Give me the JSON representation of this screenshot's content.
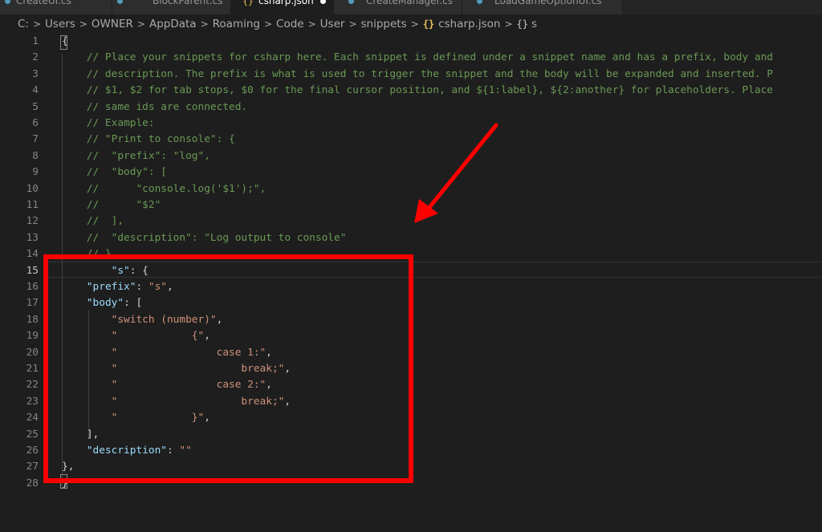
{
  "tabs": [
    {
      "label": "CreateUI.cs",
      "active": false,
      "icon": "csharp-file-icon"
    },
    {
      "label": "BlockParent.cs",
      "active": false,
      "icon": "csharp-file-icon"
    },
    {
      "label": "csharp.json",
      "active": true,
      "icon": "json-file-icon",
      "modified": true
    },
    {
      "label": "CreateManager.cs",
      "active": false,
      "icon": "csharp-file-icon"
    },
    {
      "label": "LoadGameOptionUI.cs",
      "active": false,
      "icon": "csharp-file-icon"
    }
  ],
  "breadcrumb": {
    "items": [
      "C:",
      "Users",
      "OWNER",
      "AppData",
      "Roaming",
      "Code",
      "User",
      "snippets",
      "csharp.json",
      "s"
    ],
    "json_icon": "{}",
    "object_icon": "{}"
  },
  "editor": {
    "active_line": 15,
    "lines": [
      {
        "n": "1",
        "text": "{"
      },
      {
        "n": "2",
        "text": "    // Place your snippets for csharp here. Each snippet is defined under a snippet name and has a prefix, body and"
      },
      {
        "n": "3",
        "text": "    // description. The prefix is what is used to trigger the snippet and the body will be expanded and inserted. P"
      },
      {
        "n": "4",
        "text": "    // $1, $2 for tab stops, $0 for the final cursor position, and ${1:label}, ${2:another} for placeholders. Place"
      },
      {
        "n": "5",
        "text": "    // same ids are connected."
      },
      {
        "n": "6",
        "text": "    // Example:"
      },
      {
        "n": "7",
        "text": "    // \"Print to console\": {"
      },
      {
        "n": "8",
        "text": "    //  \"prefix\": \"log\","
      },
      {
        "n": "9",
        "text": "    //  \"body\": ["
      },
      {
        "n": "10",
        "text": "    //      \"console.log('$1');\","
      },
      {
        "n": "11",
        "text": "    //      \"$2\""
      },
      {
        "n": "12",
        "text": "    //  ],"
      },
      {
        "n": "13",
        "text": "    //  \"description\": \"Log output to console\""
      },
      {
        "n": "14",
        "text": "    // }"
      },
      {
        "n": "15",
        "text": "        \"s\": {"
      },
      {
        "n": "16",
        "text": "    \"prefix\": \"s\","
      },
      {
        "n": "17",
        "text": "    \"body\": ["
      },
      {
        "n": "18",
        "text": "        \"switch (number)\","
      },
      {
        "n": "19",
        "text": "        \"            {\","
      },
      {
        "n": "20",
        "text": "        \"                case 1:\","
      },
      {
        "n": "21",
        "text": "        \"                    break;\","
      },
      {
        "n": "22",
        "text": "        \"                case 2:\","
      },
      {
        "n": "23",
        "text": "        \"                    break;\","
      },
      {
        "n": "24",
        "text": "        \"            }\","
      },
      {
        "n": "25",
        "text": "    ],"
      },
      {
        "n": "26",
        "text": "    \"description\": \"\""
      },
      {
        "n": "27",
        "text": "},"
      },
      {
        "n": "28",
        "text": "}"
      }
    ]
  },
  "colors": {
    "background": "#1e1e1e",
    "comment": "#6a9955",
    "key": "#9cdcfe",
    "string": "#ce9178",
    "annotation": "#ff0000"
  }
}
